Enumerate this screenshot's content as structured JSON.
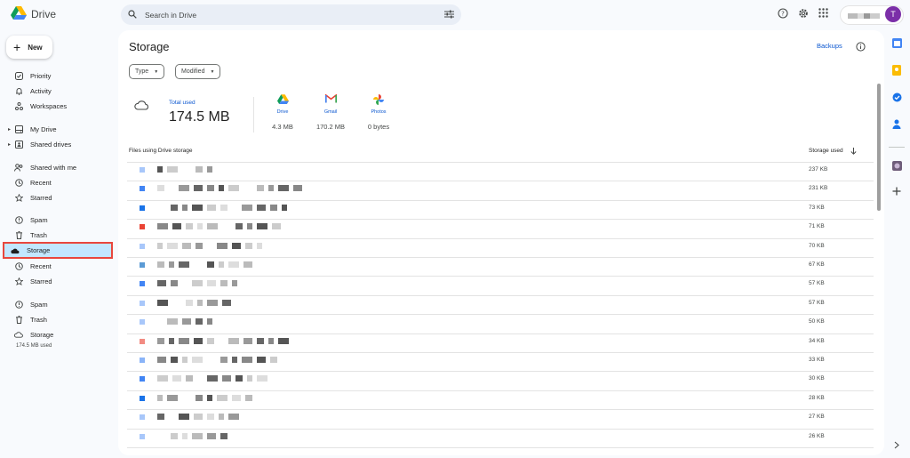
{
  "app": {
    "name": "Drive"
  },
  "search": {
    "placeholder": "Search in Drive"
  },
  "account": {
    "initial": "T"
  },
  "sidebar": {
    "new_label": "New",
    "items": [
      {
        "label": "Priority",
        "icon": "priority-icon"
      },
      {
        "label": "Activity",
        "icon": "activity-icon"
      },
      {
        "label": "Workspaces",
        "icon": "workspaces-icon"
      },
      {
        "label": "My Drive",
        "icon": "my-drive-icon"
      },
      {
        "label": "Shared drives",
        "icon": "shared-drives-icon"
      },
      {
        "label": "Shared with me",
        "icon": "shared-with-me-icon"
      },
      {
        "label": "Recent",
        "icon": "clock-icon"
      },
      {
        "label": "Starred",
        "icon": "star-icon"
      },
      {
        "label": "Spam",
        "icon": "spam-icon"
      },
      {
        "label": "Trash",
        "icon": "trash-icon"
      },
      {
        "label": "Storage",
        "icon": "cloud-icon",
        "active": true
      },
      {
        "label": "Recent",
        "icon": "clock-icon"
      },
      {
        "label": "Starred",
        "icon": "star-icon"
      },
      {
        "label": "Spam",
        "icon": "spam-icon"
      },
      {
        "label": "Trash",
        "icon": "trash-icon"
      },
      {
        "label": "Storage",
        "icon": "cloud-icon"
      }
    ],
    "storage_used": "174.5 MB used"
  },
  "main": {
    "title": "Storage",
    "backups_label": "Backups",
    "filters": [
      {
        "label": "Type"
      },
      {
        "label": "Modified"
      }
    ],
    "total": {
      "label": "Total used",
      "value": "174.5 MB"
    },
    "services": [
      {
        "name": "Drive",
        "value": "4.3 MB"
      },
      {
        "name": "Gmail",
        "value": "170.2 MB"
      },
      {
        "name": "Photos",
        "value": "0 bytes"
      }
    ],
    "table": {
      "files_header": "Files using Drive storage",
      "size_header": "Storage used",
      "rows": [
        {
          "size": "237 KB",
          "icon_color": "#a8c7fa"
        },
        {
          "size": "231 KB",
          "icon_color": "#4285f4"
        },
        {
          "size": "73 KB",
          "icon_color": "#1a73e8"
        },
        {
          "size": "71 KB",
          "icon_color": "#ea4335"
        },
        {
          "size": "70 KB",
          "icon_color": "#a8c7fa"
        },
        {
          "size": "67 KB",
          "icon_color": "#5b9bd5"
        },
        {
          "size": "57 KB",
          "icon_color": "#4285f4"
        },
        {
          "size": "57 KB",
          "icon_color": "#a8c7fa"
        },
        {
          "size": "50 KB",
          "icon_color": "#a8c7fa"
        },
        {
          "size": "34 KB",
          "icon_color": "#f28b82"
        },
        {
          "size": "33 KB",
          "icon_color": "#8ab4f8"
        },
        {
          "size": "30 KB",
          "icon_color": "#4285f4"
        },
        {
          "size": "28 KB",
          "icon_color": "#1a73e8"
        },
        {
          "size": "27 KB",
          "icon_color": "#a8c7fa"
        },
        {
          "size": "26 KB",
          "icon_color": "#a8c7fa"
        }
      ]
    }
  },
  "colors": {
    "accent": "#0b57d0",
    "active_bg": "#c2e7ff",
    "highlight_border": "#e8473d",
    "avatar": "#7b2fa8"
  }
}
